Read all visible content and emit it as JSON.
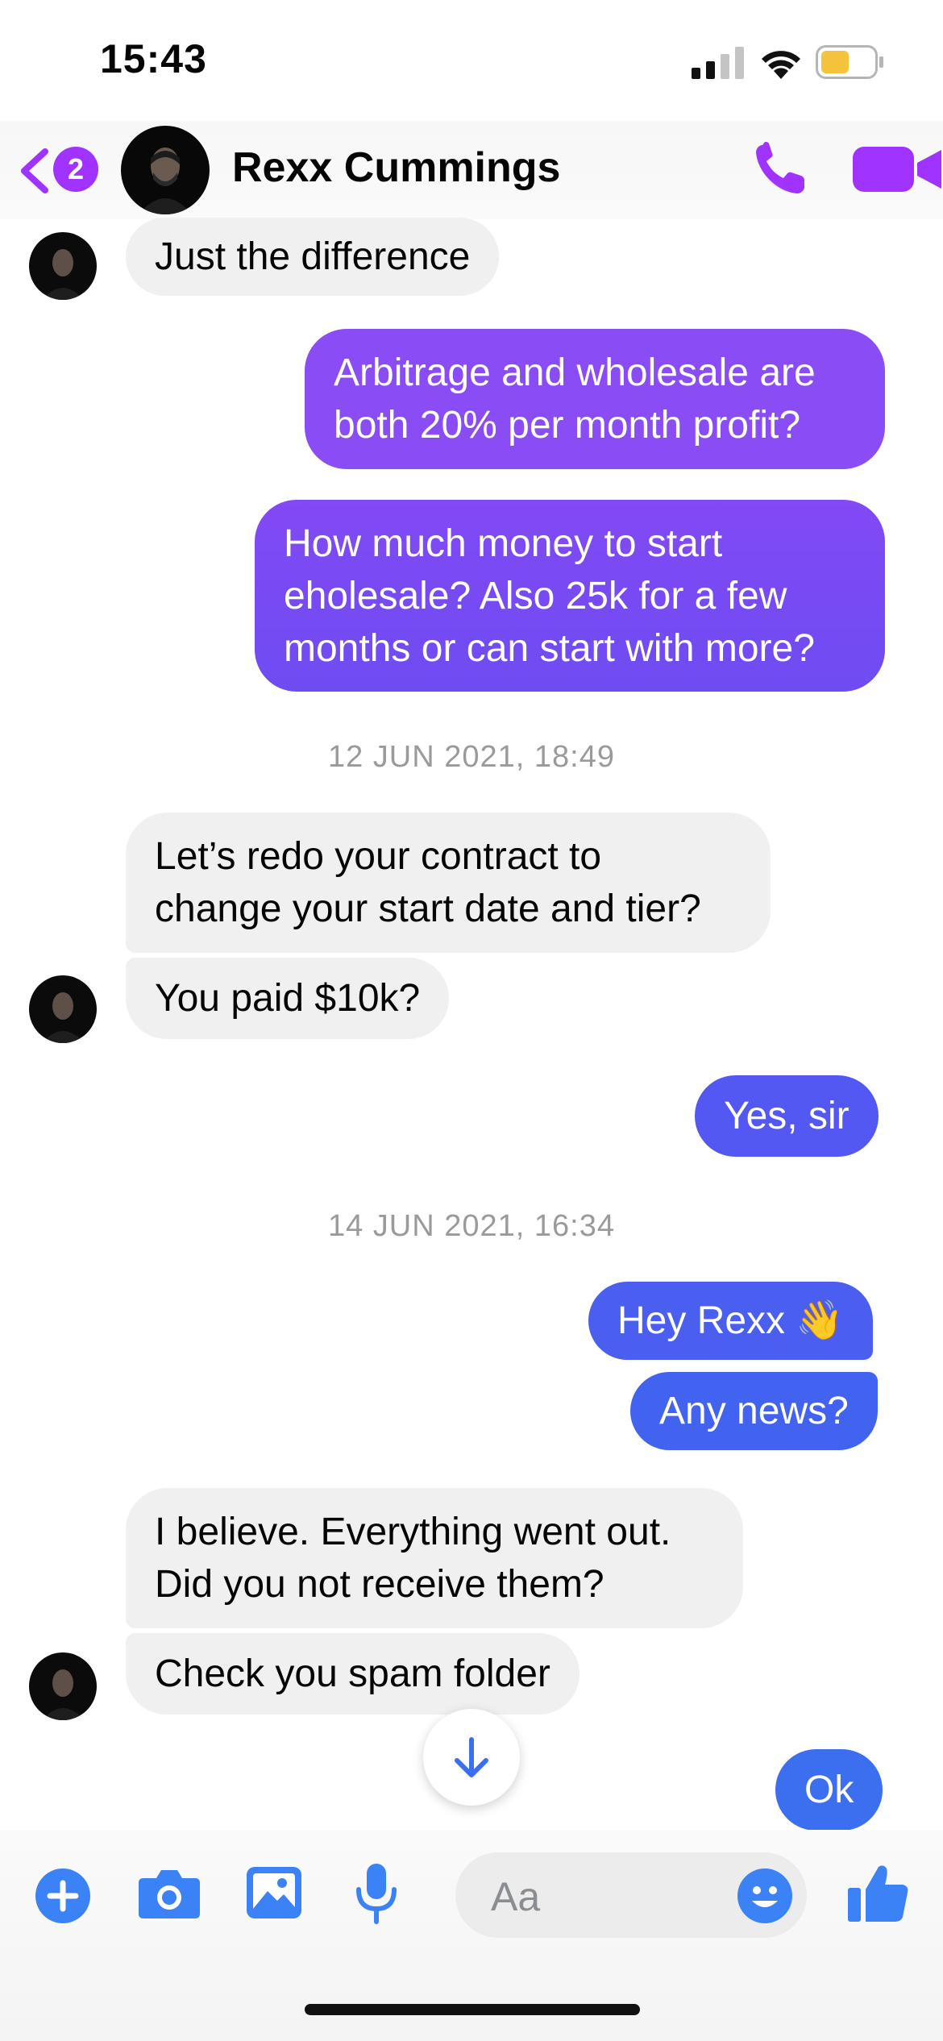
{
  "status_bar": {
    "time": "15:43"
  },
  "header": {
    "back_badge": "2",
    "contact_name": "Rexx Cummings"
  },
  "messages": [
    {
      "text": "Just the difference"
    },
    {
      "line1": "Arbitrage and wholesale are",
      "line2": "both 20% per month profit?"
    },
    {
      "line1": "How much money to start",
      "line2": "eholesale? Also 25k for a few",
      "line3": "months or can start with more?"
    },
    {
      "line1": "Let’s redo your contract to",
      "line2": "change your start date and tier?"
    },
    {
      "text": "You paid $10k?"
    },
    {
      "text": "Yes, sir"
    },
    {
      "text": "Hey Rexx 👋"
    },
    {
      "text": "Any news?"
    },
    {
      "line1": "I believe. Everything went out.",
      "line2": "Did you not receive them?"
    },
    {
      "text": "Check you spam folder"
    },
    {
      "text": "Ok"
    }
  ],
  "timestamps": [
    "12 JUN 2021, 18:49",
    "14 JUN 2021, 16:34"
  ],
  "composer": {
    "placeholder": "Aa"
  },
  "colors": {
    "accent_purple": "#a033ff",
    "outgoing_purple": "#8a4df5",
    "outgoing_blue": "#4a5ff0",
    "incoming_gray": "#f0f0f0",
    "messenger_blue": "#3b82f6"
  }
}
